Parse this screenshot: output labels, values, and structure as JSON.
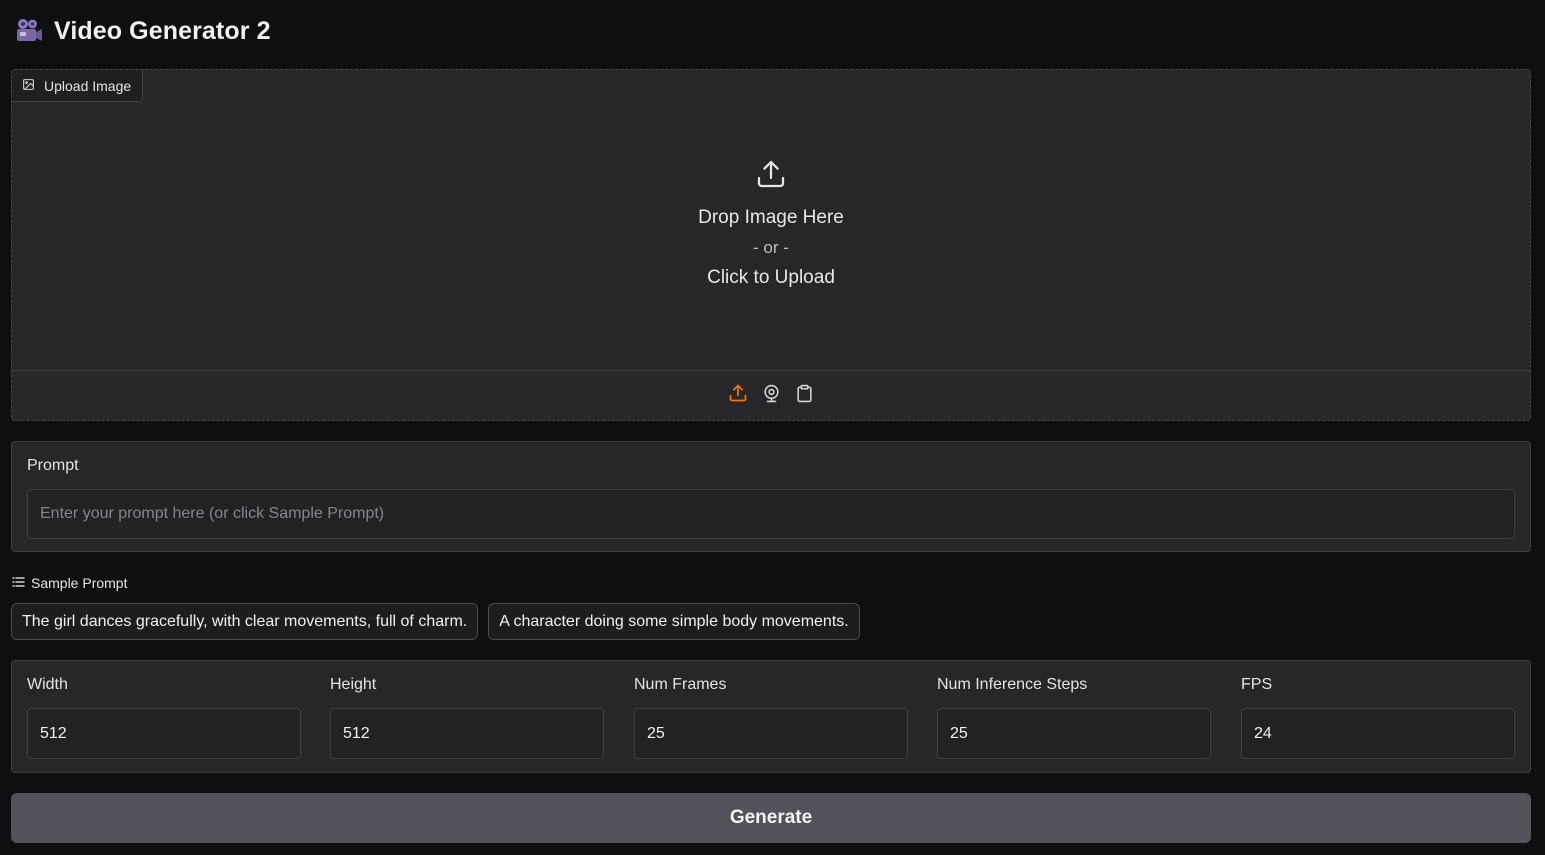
{
  "app": {
    "title": "Video Generator 2",
    "title_icon": "movie-camera-icon"
  },
  "upload": {
    "label": "Upload Image",
    "label_icon": "image-icon",
    "drop_text": "Drop Image Here",
    "or_text": "- or -",
    "click_text": "Click to Upload",
    "sources": [
      {
        "name": "upload",
        "icon": "upload-icon",
        "active": true
      },
      {
        "name": "webcam",
        "icon": "webcam-icon",
        "active": false
      },
      {
        "name": "clipboard",
        "icon": "clipboard-icon",
        "active": false
      }
    ]
  },
  "prompt": {
    "label": "Prompt",
    "placeholder": "Enter your prompt here (or click Sample Prompt)",
    "value": ""
  },
  "samples": {
    "label": "Sample Prompt",
    "items": [
      "The girl dances gracefully, with clear movements, full of charm.",
      "A character doing some simple body movements."
    ]
  },
  "params": {
    "width": {
      "label": "Width",
      "value": "512"
    },
    "height": {
      "label": "Height",
      "value": "512"
    },
    "num_frames": {
      "label": "Num Frames",
      "value": "25"
    },
    "num_inference_steps": {
      "label": "Num Inference Steps",
      "value": "25"
    },
    "fps": {
      "label": "FPS",
      "value": "24"
    }
  },
  "actions": {
    "generate_label": "Generate"
  },
  "colors": {
    "background": "#0f0f11",
    "panel": "#27272a",
    "border": "#3f3f45",
    "accent": "#f97316",
    "button": "#52525b"
  }
}
